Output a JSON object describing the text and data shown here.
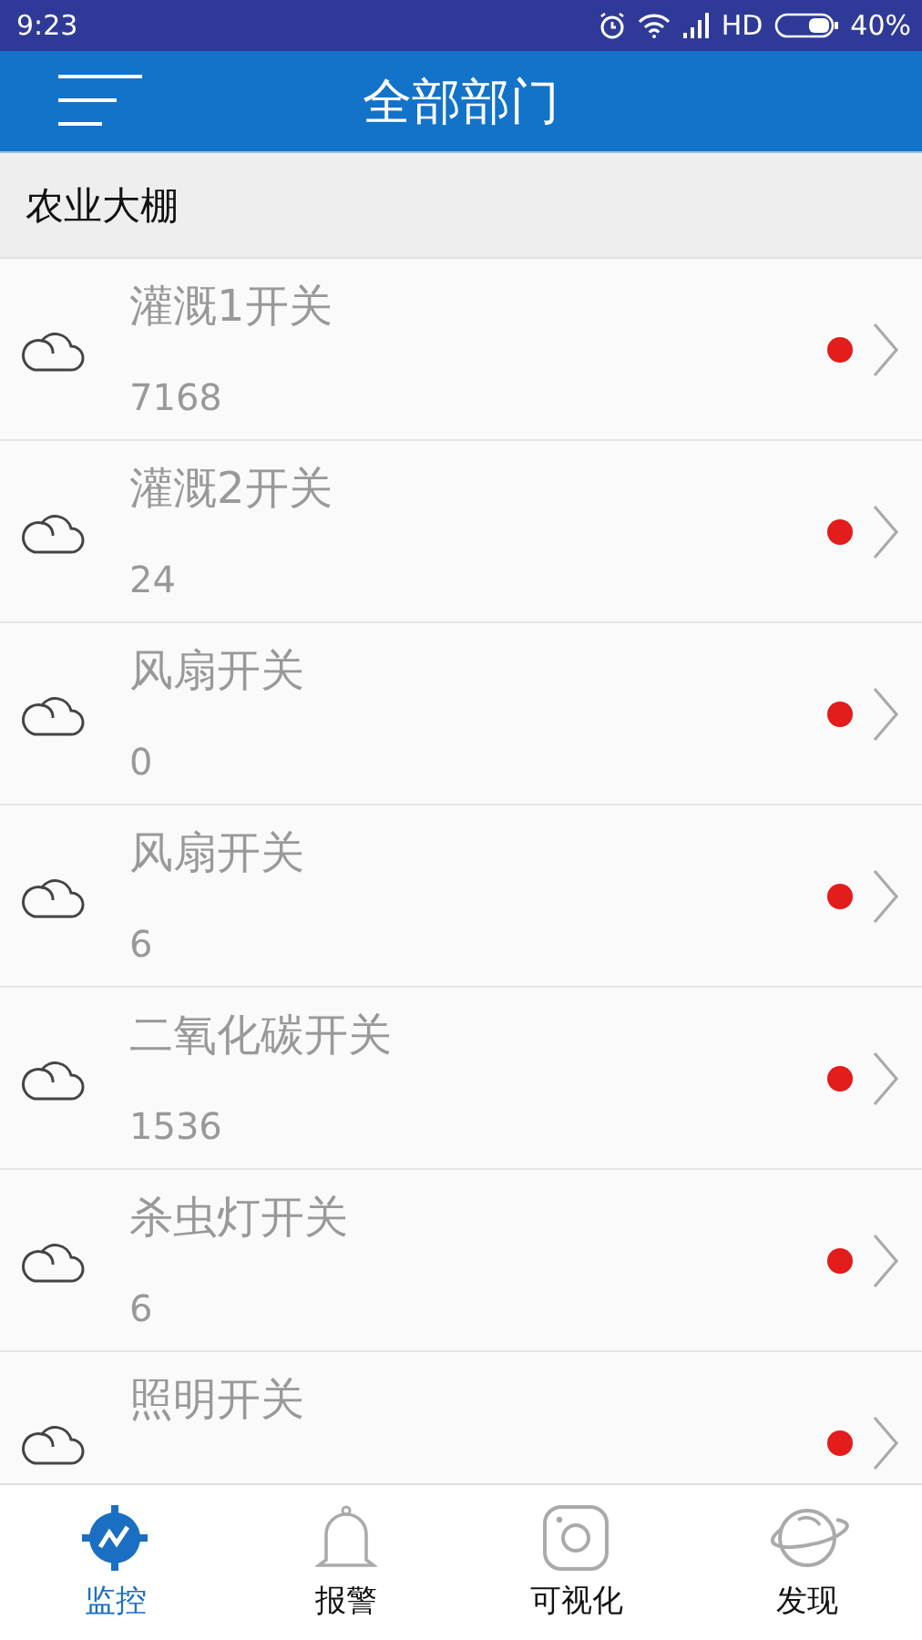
{
  "status_bar": {
    "time": "9:23",
    "network": "HD",
    "battery": "40%"
  },
  "app_bar": {
    "title": "全部部门"
  },
  "section": {
    "title": "农业大棚"
  },
  "devices": [
    {
      "name": "灌溉1开关",
      "value": "7168",
      "color": "#e31c1c"
    },
    {
      "name": "灌溉2开关",
      "value": "24",
      "color": "#e31c1c"
    },
    {
      "name": "风扇开关",
      "value": "0",
      "color": "#e31c1c"
    },
    {
      "name": "风扇开关",
      "value": "6",
      "color": "#e31c1c"
    },
    {
      "name": "二氧化碳开关",
      "value": "1536",
      "color": "#e31c1c"
    },
    {
      "name": "杀虫灯开关",
      "value": "6",
      "color": "#e31c1c"
    },
    {
      "name": "照明开关",
      "color": "#e31c1c"
    }
  ],
  "tabs": [
    {
      "kind": "monitor",
      "label": "监控",
      "selected": true
    },
    {
      "kind": "alarm",
      "label": "报警",
      "selected": false
    },
    {
      "kind": "camera",
      "label": "可视化",
      "selected": false
    },
    {
      "kind": "planet",
      "label": "发现",
      "selected": false
    }
  ]
}
